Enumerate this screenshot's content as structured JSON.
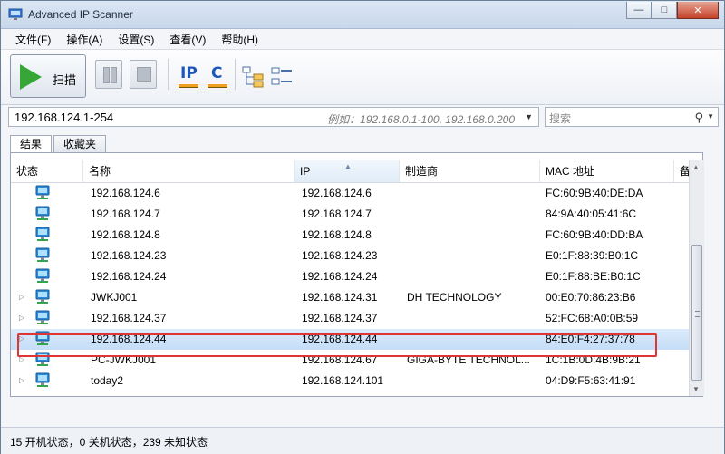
{
  "window": {
    "title": "Advanced IP Scanner",
    "minimize": "—",
    "maximize": "□",
    "close": "✕"
  },
  "menu": [
    "文件(F)",
    "操作(A)",
    "设置(S)",
    "查看(V)",
    "帮助(H)"
  ],
  "toolbar": {
    "scan_label": "扫描",
    "ip_label": "IP",
    "c_label": "C"
  },
  "address": {
    "range_value": "192.168.124.1-254",
    "range_hint": "例如：192.168.0.1-100, 192.168.0.200",
    "search_placeholder": "搜索"
  },
  "tabs": [
    {
      "label": "结果",
      "active": true
    },
    {
      "label": "收藏夹",
      "active": false
    }
  ],
  "columns": [
    "状态",
    "名称",
    "IP",
    "制造商",
    "MAC 地址",
    "备"
  ],
  "rows": [
    {
      "name": "192.168.124.6",
      "ip": "192.168.124.6",
      "vendor": "",
      "mac": "FC:60:9B:40:DE:DA",
      "expandable": false,
      "selected": false
    },
    {
      "name": "192.168.124.7",
      "ip": "192.168.124.7",
      "vendor": "",
      "mac": "84:9A:40:05:41:6C",
      "expandable": false,
      "selected": false
    },
    {
      "name": "192.168.124.8",
      "ip": "192.168.124.8",
      "vendor": "",
      "mac": "FC:60:9B:40:DD:BA",
      "expandable": false,
      "selected": false
    },
    {
      "name": "192.168.124.23",
      "ip": "192.168.124.23",
      "vendor": "",
      "mac": "E0:1F:88:39:B0:1C",
      "expandable": false,
      "selected": false
    },
    {
      "name": "192.168.124.24",
      "ip": "192.168.124.24",
      "vendor": "",
      "mac": "E0:1F:88:BE:B0:1C",
      "expandable": false,
      "selected": false
    },
    {
      "name": "JWKJ001",
      "ip": "192.168.124.31",
      "vendor": "DH TECHNOLOGY",
      "mac": "00:E0:70:86:23:B6",
      "expandable": true,
      "selected": false
    },
    {
      "name": "192.168.124.37",
      "ip": "192.168.124.37",
      "vendor": "",
      "mac": "52:FC:68:A0:0B:59",
      "expandable": true,
      "selected": false
    },
    {
      "name": "192.168.124.44",
      "ip": "192.168.124.44",
      "vendor": "",
      "mac": "84:E0:F4:27:37:78",
      "expandable": true,
      "selected": true
    },
    {
      "name": "PC-JWKJ001",
      "ip": "192.168.124.67",
      "vendor": "GIGA-BYTE TECHNOL...",
      "mac": "1C:1B:0D:4B:9B:21",
      "expandable": true,
      "selected": false
    },
    {
      "name": "today2",
      "ip": "192.168.124.101",
      "vendor": "",
      "mac": "04:D9:F5:63:41:91",
      "expandable": true,
      "selected": false
    }
  ],
  "status": "15 开机状态，0 关机状态，239 未知状态",
  "colors": {
    "highlight": "#e03535",
    "play": "#36a736",
    "ip_icon": "#1f55b8",
    "selection": "#c5ddf7"
  },
  "icons": [
    "app-icon",
    "play-icon",
    "pause-icon",
    "stop-icon",
    "ip-icon",
    "c-icon",
    "tree-expand-icon",
    "tree-collapse-icon",
    "computer-icon",
    "search-icon",
    "chevron-down-icon"
  ]
}
